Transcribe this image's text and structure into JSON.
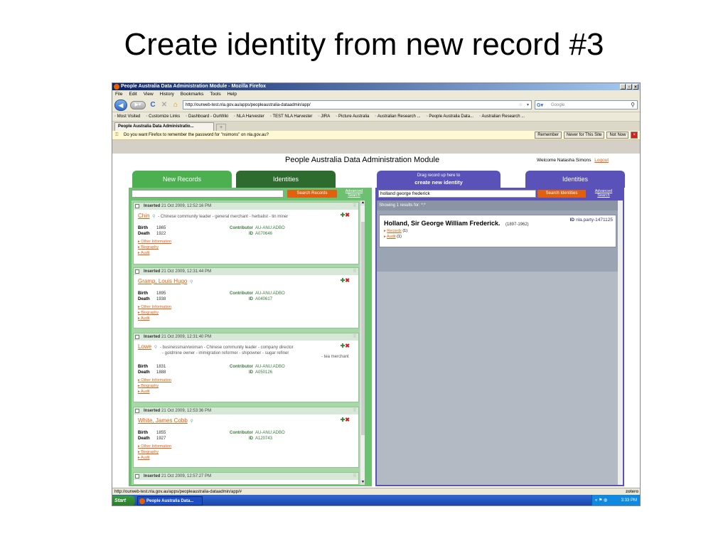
{
  "slide_title": "Create identity from new record #3",
  "browser": {
    "window_title": "People Australia Data Administration Module - Mozilla Firefox",
    "menu": [
      "File",
      "Edit",
      "View",
      "History",
      "Bookmarks",
      "Tools",
      "Help"
    ],
    "url": "http://ourweb-test.nla.gov.au/apps/peopleaustralia-dataadmin/app/",
    "search_placeholder": "Google",
    "bookmarks": [
      "Most Visited",
      "Customize Links",
      "Dashboard - OurWiki",
      "NLA Harvester",
      "TEST NLA Harvester",
      "JIRA",
      "Picture Australia",
      "Australian Research ...",
      "People Australia Data...",
      "Australian Research ..."
    ],
    "tab_label": "People Australia Data Administratio...",
    "password_prompt": "Do you want Firefox to remember the password for \"nsimons\" on nla.gov.au?",
    "password_buttons": [
      "Remember",
      "Never for This Site",
      "Not Now"
    ],
    "status_text": "http://ourweb-test.nla.gov.au/apps/peopleaustralia-dataadmin/app/#",
    "zotero": "zotero"
  },
  "app": {
    "title": "People Australia Data Administration Module",
    "welcome": "Welcome Natasha Simons",
    "logout": "Logout",
    "tabs": {
      "new_records": "New Records",
      "identities_left": "Identities",
      "drag_hint": "Drag record up here to",
      "create_identity": "create new identity",
      "identities_right": "Identities"
    },
    "left_search": {
      "value": "",
      "button": "Search Records",
      "advanced": "Advanced Search"
    },
    "right_search": {
      "value": "holland george frederick",
      "button": "Search Identities",
      "advanced": "Advanced Search"
    },
    "labels": {
      "birth": "Birth",
      "death": "Death",
      "contributor": "Contributor",
      "id": "ID",
      "other_info": "Other Information",
      "biography": "Biography",
      "audit": "Audit",
      "inserted": "Inserted"
    },
    "records": [
      {
        "timestamp": "21 Oct 2009, 12:52:16 PM",
        "name": "Chin",
        "titles": "- Chinese community leader - general merchant - herbalist - tin miner",
        "titles2": "",
        "birth": "1865",
        "death": "1922",
        "contributor": "AU-ANU:ADBO",
        "id": "A070646"
      },
      {
        "timestamp": "21 Oct 2009, 12:31:44 PM",
        "name": "Gramp, Louis Hugo",
        "titles": "",
        "titles2": "",
        "birth": "1895",
        "death": "1938",
        "contributor": "AU-ANU:ADBO",
        "id": "A040617"
      },
      {
        "timestamp": "21 Oct 2009, 12:31:40 PM",
        "name": "Lowe",
        "titles": "- businessman/woman - Chinese community leader - company director",
        "titles2": "- goldmine owner - immigration reformer - shipowner - sugar refiner",
        "titles3": "- tea merchant",
        "birth": "1831",
        "death": "1888",
        "contributor": "AU-ANU:ADBO",
        "id": "A050126"
      },
      {
        "timestamp": "21 Oct 2009, 12:53:36 PM",
        "name": "White, James Cobb",
        "titles": "",
        "titles2": "",
        "birth": "1855",
        "death": "1927",
        "contributor": "AU-ANU:ADBO",
        "id": "A120743"
      },
      {
        "timestamp": "21 Oct 2009, 12:57:27 PM"
      }
    ],
    "results": {
      "showing": "Showing 1 results for: *:*",
      "identity_name": "Holland, Sir George William Frederick.",
      "identity_dates": "(1897-1962)",
      "identity_id_label": "ID",
      "identity_id": "nla.party-1471125",
      "records_link": "Records",
      "records_count": "(1)",
      "audit_link": "Audit",
      "audit_count": "(1)"
    }
  },
  "taskbar": {
    "start": "Start",
    "task": "People Australia Data...",
    "clock": "3:33 PM"
  }
}
